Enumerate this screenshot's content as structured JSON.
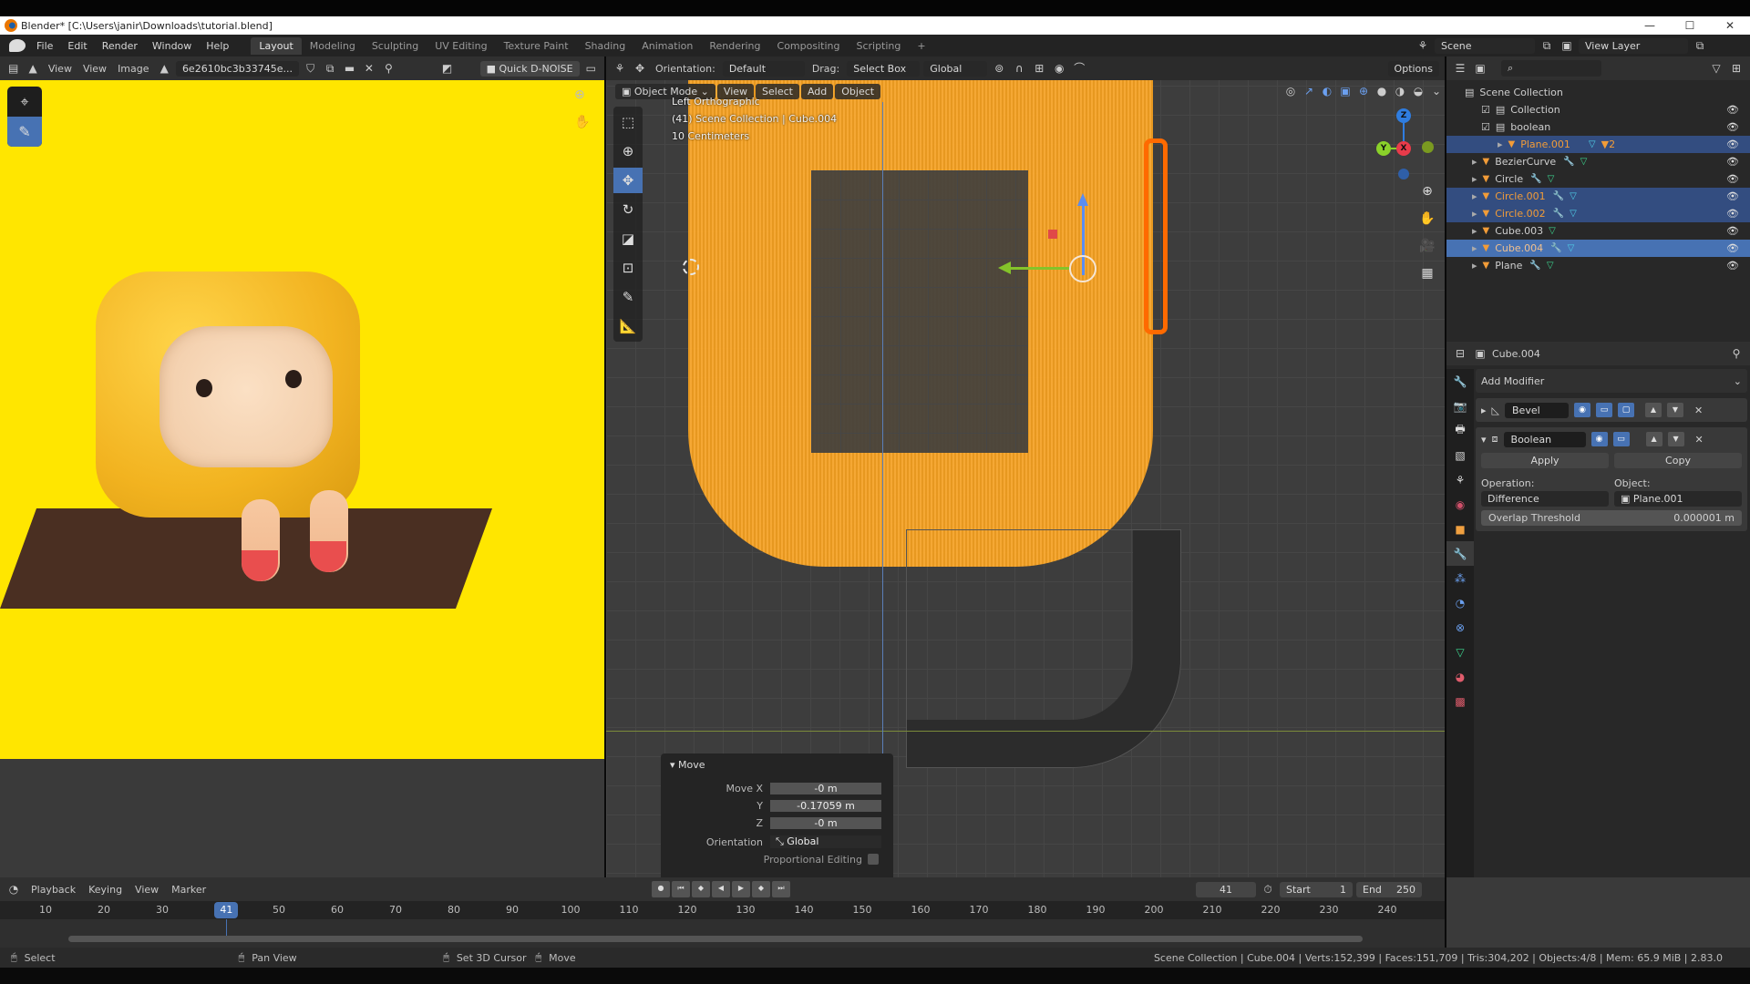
{
  "window": {
    "title": "Blender* [C:\\Users\\janir\\Downloads\\tutorial.blend]",
    "controls": {
      "minimize": "—",
      "maximize": "☐",
      "close": "✕"
    }
  },
  "menubar": {
    "menus": [
      "File",
      "Edit",
      "Render",
      "Window",
      "Help"
    ],
    "workspaces": [
      "Layout",
      "Modeling",
      "Sculpting",
      "UV Editing",
      "Texture Paint",
      "Shading",
      "Animation",
      "Rendering",
      "Compositing",
      "Scripting"
    ],
    "active_workspace": "Layout",
    "add_workspace": "+",
    "scene_label": "Scene",
    "view_layer_label": "View Layer"
  },
  "image_editor": {
    "header": {
      "view_dropdown": "View",
      "view_menu": "View",
      "image_menu": "Image",
      "image_name": "6e2610bc3b33745e...",
      "denoise_button": "Quick D-NOISE"
    },
    "tools": [
      "sample-tool",
      "annotate-tool"
    ],
    "active_tool": "annotate-tool"
  },
  "toolbar3d": {
    "orientation_label": "Orientation:",
    "orientation_value": "Default",
    "drag_label": "Drag:",
    "drag_value": "Select Box",
    "transform_orientation": "Global",
    "options_label": "Options"
  },
  "viewport": {
    "mode": "Object Mode",
    "menus": [
      "View",
      "Select",
      "Add",
      "Object"
    ],
    "view_name": "Left Orthographic",
    "collection_info": "(41) Scene Collection | Cube.004",
    "scale_info": "10 Centimeters",
    "tools": [
      "select-box",
      "cursor",
      "move",
      "rotate",
      "scale",
      "transform",
      "annotate",
      "measure"
    ],
    "active_tool": "move",
    "gizmo_axes": [
      "Z",
      "Y",
      "X"
    ]
  },
  "move_panel": {
    "title": "Move",
    "rows": [
      {
        "label": "Move X",
        "value": "-0 m"
      },
      {
        "label": "Y",
        "value": "-0.17059 m"
      },
      {
        "label": "Z",
        "value": "-0 m"
      }
    ],
    "orientation_label": "Orientation",
    "orientation_value": "Global",
    "proportional_label": "Proportional Editing",
    "proportional_checked": false
  },
  "outliner": {
    "root": "Scene Collection",
    "items": [
      {
        "name": "Collection",
        "type": "collection",
        "checked": true,
        "state": ""
      },
      {
        "name": "boolean",
        "type": "collection",
        "checked": true,
        "state": ""
      },
      {
        "name": "Plane.001",
        "type": "object",
        "state": "selected",
        "badge": "2"
      },
      {
        "name": "BezierCurve",
        "type": "object",
        "state": ""
      },
      {
        "name": "Circle",
        "type": "object",
        "state": ""
      },
      {
        "name": "Circle.001",
        "type": "object",
        "state": "selected"
      },
      {
        "name": "Circle.002",
        "type": "object",
        "state": "selected"
      },
      {
        "name": "Cube.003",
        "type": "object",
        "state": ""
      },
      {
        "name": "Cube.004",
        "type": "object",
        "state": "active"
      },
      {
        "name": "Plane",
        "type": "object",
        "state": ""
      }
    ]
  },
  "properties": {
    "object_name": "Cube.004",
    "add_modifier": "Add Modifier",
    "modifiers": [
      {
        "name": "Bevel",
        "expanded": false
      },
      {
        "name": "Boolean",
        "expanded": true
      }
    ],
    "apply_label": "Apply",
    "copy_label": "Copy",
    "operation_label": "Operation:",
    "operation_value": "Difference",
    "object_label": "Object:",
    "object_value": "Plane.001",
    "overlap_label": "Overlap Threshold",
    "overlap_value": "0.000001 m"
  },
  "timeline": {
    "menus": [
      "Playback",
      "Keying",
      "View",
      "Marker"
    ],
    "current_frame": "41",
    "start_label": "Start",
    "start_value": "1",
    "end_label": "End",
    "end_value": "250",
    "ticks": [
      "10",
      "20",
      "30",
      "50",
      "60",
      "70",
      "80",
      "90",
      "100",
      "110",
      "120",
      "130",
      "140",
      "150",
      "160",
      "170",
      "180",
      "190",
      "200",
      "210",
      "220",
      "230",
      "240"
    ],
    "frame_indicator": "41"
  },
  "statusbar": {
    "select": "Select",
    "pan": "Pan View",
    "cursor": "Set 3D Cursor",
    "move": "Move",
    "stats": "Scene Collection | Cube.004 | Verts:152,399 | Faces:151,709 | Tris:304,202 | Objects:4/8 | Mem: 65.9 MiB | 2.83.0"
  },
  "colors": {
    "accent": "#4772b3",
    "selected_object": "#f29c38",
    "image_bg": "#ffe600"
  }
}
